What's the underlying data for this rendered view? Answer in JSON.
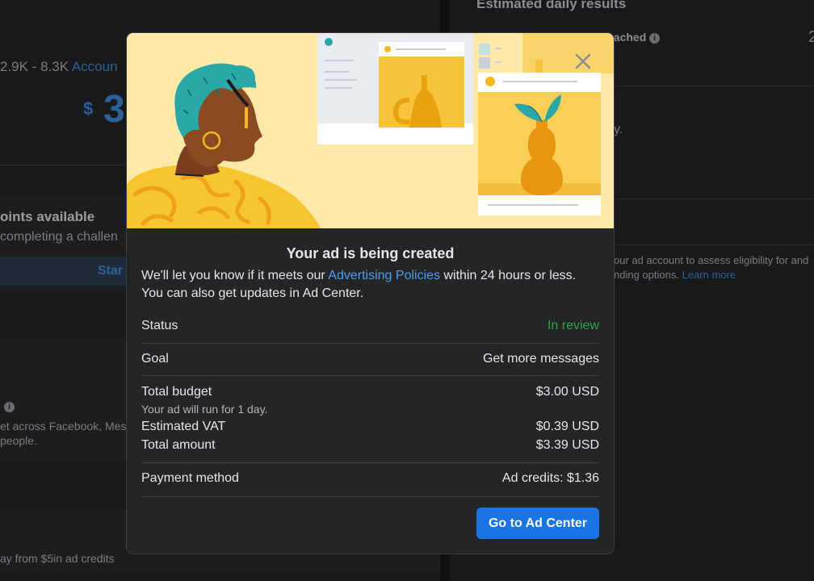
{
  "background": {
    "estimated_daily_results": "Estimated daily results",
    "reached": "eached",
    "reached_count": "2",
    "accounts_range_prefix": "2.9K - 8.3K ",
    "accounts_range_link": "Accoun",
    "currency": "$",
    "big_amount": "3",
    "daily_hint": "y.",
    "points_available": "oints available",
    "completing_challenge": " completing a challen",
    "start_button": "Star",
    "across_text": "et across Facebook, Mess",
    "people_text": "people.",
    "eligibility_text_1": "our ad account to assess eligibility for and",
    "eligibility_text_2": "nding options.",
    "learn_more": "Learn more",
    "credits_text": "ay from $5in ad credits"
  },
  "modal": {
    "title": "Your ad is being created",
    "desc_before_link": "We'll let you know if it meets our ",
    "desc_link": "Advertising Policies",
    "desc_after_link": " within 24 hours or less.",
    "desc_line2": "You can also get updates in Ad Center.",
    "rows": {
      "status_label": "Status",
      "status_value": "In review",
      "goal_label": "Goal",
      "goal_value": "Get more messages",
      "total_budget_label": "Total budget",
      "total_budget_value": "$3.00 USD",
      "run_note": "Your ad will run for 1 day.",
      "vat_label": "Estimated VAT",
      "vat_value": "$0.39 USD",
      "total_amount_label": "Total amount",
      "total_amount_value": "$3.39 USD",
      "payment_label": "Payment method",
      "payment_value": "Ad credits: $1.36"
    },
    "primary_button": "Go to Ad Center",
    "close_icon": "close-icon"
  },
  "colors": {
    "accent_blue": "#1b74e4",
    "link_blue": "#4b9cf5",
    "status_green": "#31a24c",
    "modal_bg": "#242526"
  }
}
